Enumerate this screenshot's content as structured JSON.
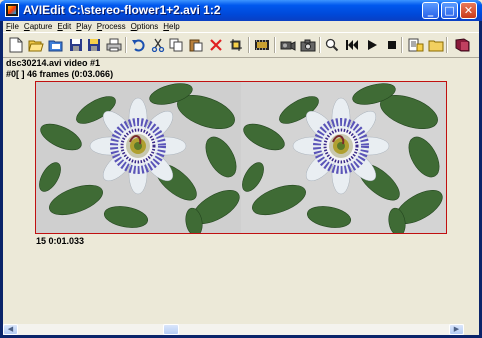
{
  "window": {
    "title": "AVIEdit C:\\stereo-flower1+2.avi  1:2"
  },
  "title_buttons": {
    "minimize": "_",
    "maximize": "□",
    "close": "✕"
  },
  "menu": [
    {
      "u": "F",
      "rest": "ile"
    },
    {
      "u": "C",
      "rest": "apture"
    },
    {
      "u": "E",
      "rest": "dit"
    },
    {
      "u": "P",
      "rest": "lay"
    },
    {
      "u": "P",
      "rest": "rocess"
    },
    {
      "u": "O",
      "rest": "ptions"
    },
    {
      "u": "H",
      "rest": "elp"
    }
  ],
  "toolbar_icons": [
    "new-icon",
    "open-icon",
    "open-folder-icon",
    "save-icon",
    "save-as-icon",
    "save-copy-icon",
    "print-icon",
    "undo-icon",
    "cut-icon",
    "copy-icon",
    "paste-icon",
    "delete-icon",
    "crop-icon",
    "film-icon",
    "camera-icon",
    "snapshot-icon",
    "zoom-icon",
    "rewind-icon",
    "play-icon",
    "stop-icon",
    "properties-icon",
    "folder-icon",
    "book-icon"
  ],
  "info": {
    "source": "dsc30214.avi video #1",
    "frame_line": "#0[   ] 46 frames (0:03.066)",
    "position": "15 0:01.033"
  },
  "colors": {
    "accent_border": "#c01010",
    "titlebar": "#0058ee"
  }
}
